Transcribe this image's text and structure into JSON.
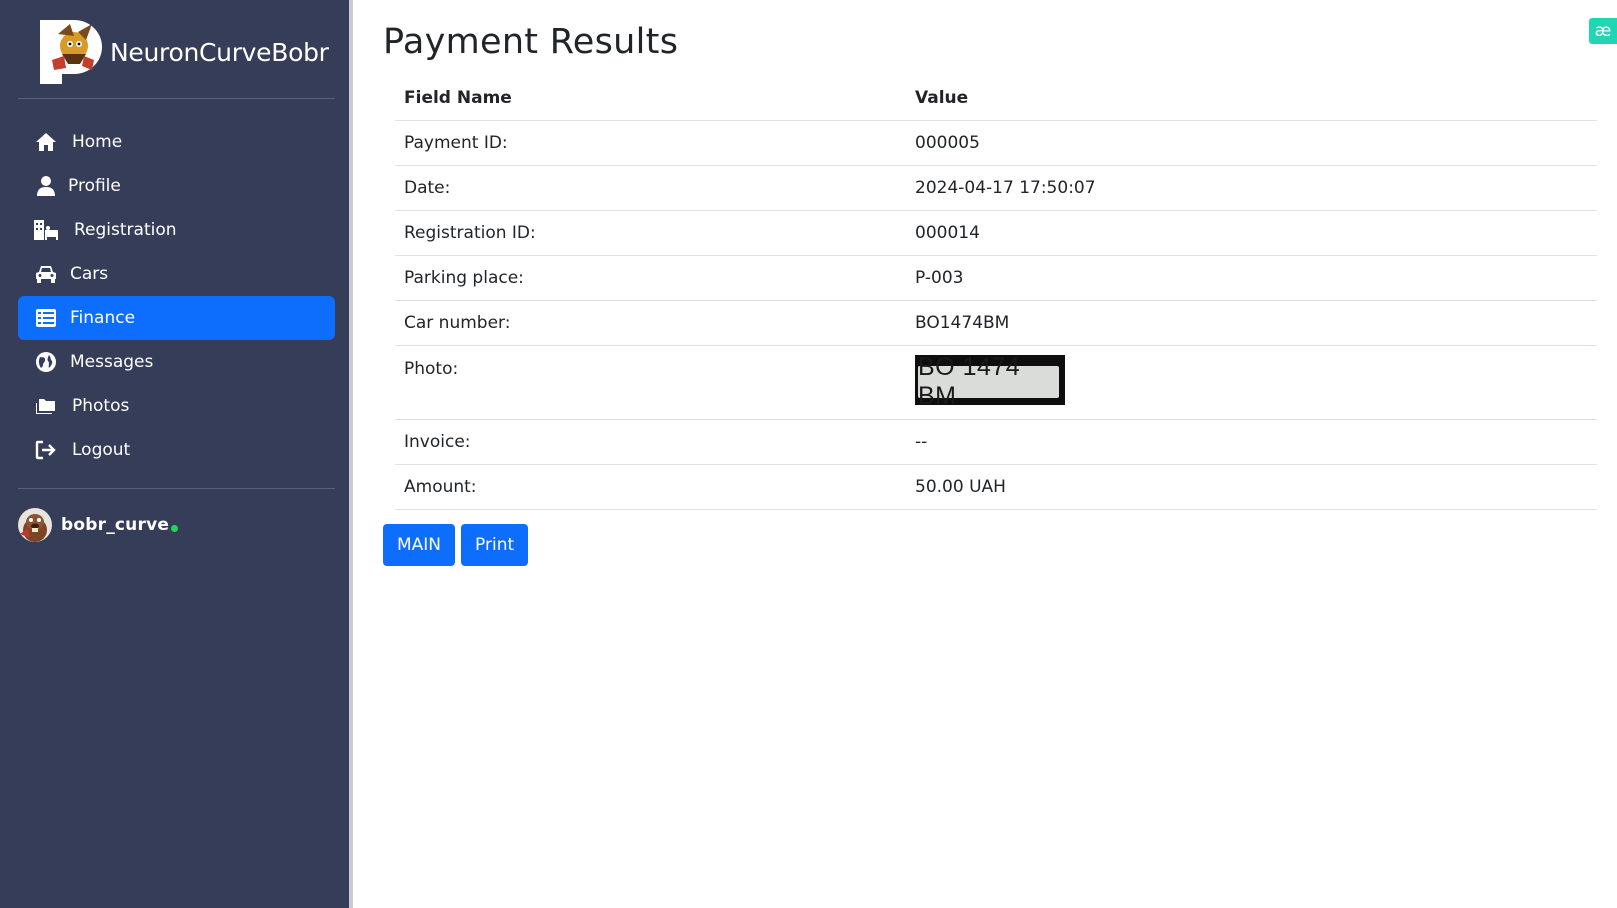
{
  "brand": {
    "name": "NeuronCurveBobr"
  },
  "sidebar": {
    "items": [
      {
        "label": "Home",
        "icon": "home-icon",
        "active": false
      },
      {
        "label": "Profile",
        "icon": "user-icon",
        "active": false
      },
      {
        "label": "Registration",
        "icon": "hotel-icon",
        "active": false
      },
      {
        "label": "Cars",
        "icon": "car-icon",
        "active": false
      },
      {
        "label": "Finance",
        "icon": "list-icon",
        "active": true
      },
      {
        "label": "Messages",
        "icon": "globe-icon",
        "active": false
      },
      {
        "label": "Photos",
        "icon": "folder-icon",
        "active": false
      },
      {
        "label": "Logout",
        "icon": "logout-icon",
        "active": false
      }
    ],
    "user": {
      "name": "bobr_curve",
      "status_color": "#1fd655"
    }
  },
  "page": {
    "title": "Payment Results",
    "table": {
      "headers": [
        "Field Name",
        "Value"
      ],
      "rows": [
        {
          "field": "Payment ID:",
          "value": "000005"
        },
        {
          "field": "Date:",
          "value": "2024-04-17 17:50:07"
        },
        {
          "field": "Registration ID:",
          "value": "000014"
        },
        {
          "field": "Parking place:",
          "value": "P-003"
        },
        {
          "field": "Car number:",
          "value": "BO1474BM"
        },
        {
          "field": "Photo:",
          "value": "BO 1474 BM"
        },
        {
          "field": "Invoice:",
          "value": "--"
        },
        {
          "field": "Amount:",
          "value": "50.00 UAH"
        }
      ]
    },
    "buttons": {
      "main": "MAIN",
      "print": "Print"
    }
  },
  "extension_badge": {
    "glyph": "æ"
  },
  "colors": {
    "sidebar_bg": "#363d58",
    "accent": "#0d6efd",
    "badge": "#21d6b3"
  }
}
